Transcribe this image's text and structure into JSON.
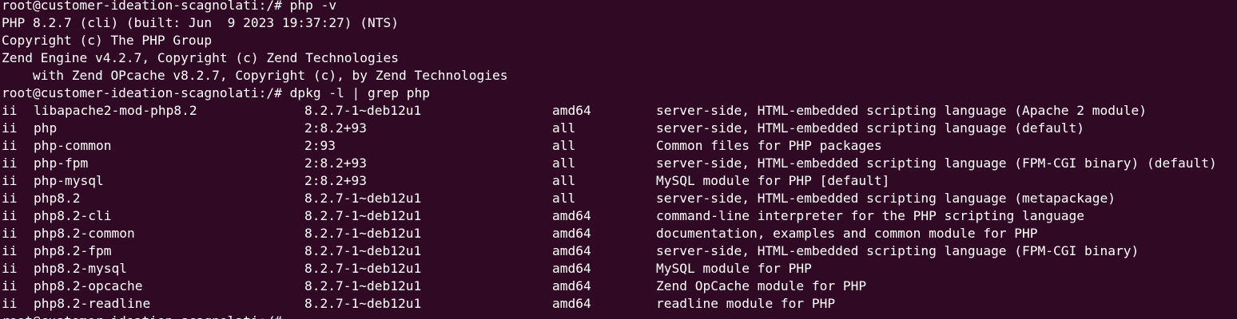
{
  "terminal": {
    "background_color": "#300a24",
    "text_color": "#ffffff",
    "pre_lines": [
      "root@customer-ideation-scagnolati:/# php -v",
      "PHP 8.2.7 (cli) (built: Jun  9 2023 19:37:27) (NTS)",
      "Copyright (c) The PHP Group",
      "Zend Engine v4.2.7, Copyright (c) Zend Technologies",
      "    with Zend OPcache v8.2.7, Copyright (c), by Zend Technologies",
      "root@customer-ideation-scagnolati:/# dpkg -l | grep php"
    ],
    "packages": [
      {
        "status": "ii",
        "name": "libapache2-mod-php8.2",
        "version": "8.2.7-1~deb12u1",
        "arch": "amd64",
        "description": "server-side, HTML-embedded scripting language (Apache 2 module)"
      },
      {
        "status": "ii",
        "name": "php",
        "version": "2:8.2+93",
        "arch": "all",
        "description": "server-side, HTML-embedded scripting language (default)"
      },
      {
        "status": "ii",
        "name": "php-common",
        "version": "2:93",
        "arch": "all",
        "description": "Common files for PHP packages"
      },
      {
        "status": "ii",
        "name": "php-fpm",
        "version": "2:8.2+93",
        "arch": "all",
        "description": "server-side, HTML-embedded scripting language (FPM-CGI binary) (default)"
      },
      {
        "status": "ii",
        "name": "php-mysql",
        "version": "2:8.2+93",
        "arch": "all",
        "description": "MySQL module for PHP [default]"
      },
      {
        "status": "ii",
        "name": "php8.2",
        "version": "8.2.7-1~deb12u1",
        "arch": "all",
        "description": "server-side, HTML-embedded scripting language (metapackage)"
      },
      {
        "status": "ii",
        "name": "php8.2-cli",
        "version": "8.2.7-1~deb12u1",
        "arch": "amd64",
        "description": "command-line interpreter for the PHP scripting language"
      },
      {
        "status": "ii",
        "name": "php8.2-common",
        "version": "8.2.7-1~deb12u1",
        "arch": "amd64",
        "description": "documentation, examples and common module for PHP"
      },
      {
        "status": "ii",
        "name": "php8.2-fpm",
        "version": "8.2.7-1~deb12u1",
        "arch": "amd64",
        "description": "server-side, HTML-embedded scripting language (FPM-CGI binary)"
      },
      {
        "status": "ii",
        "name": "php8.2-mysql",
        "version": "8.2.7-1~deb12u1",
        "arch": "amd64",
        "description": "MySQL module for PHP"
      },
      {
        "status": "ii",
        "name": "php8.2-opcache",
        "version": "8.2.7-1~deb12u1",
        "arch": "amd64",
        "description": "Zend OpCache module for PHP"
      },
      {
        "status": "ii",
        "name": "php8.2-readline",
        "version": "8.2.7-1~deb12u1",
        "arch": "amd64",
        "description": "readline module for PHP"
      }
    ],
    "last_prompt": "root@customer-ideation-scagnolati:/#"
  }
}
